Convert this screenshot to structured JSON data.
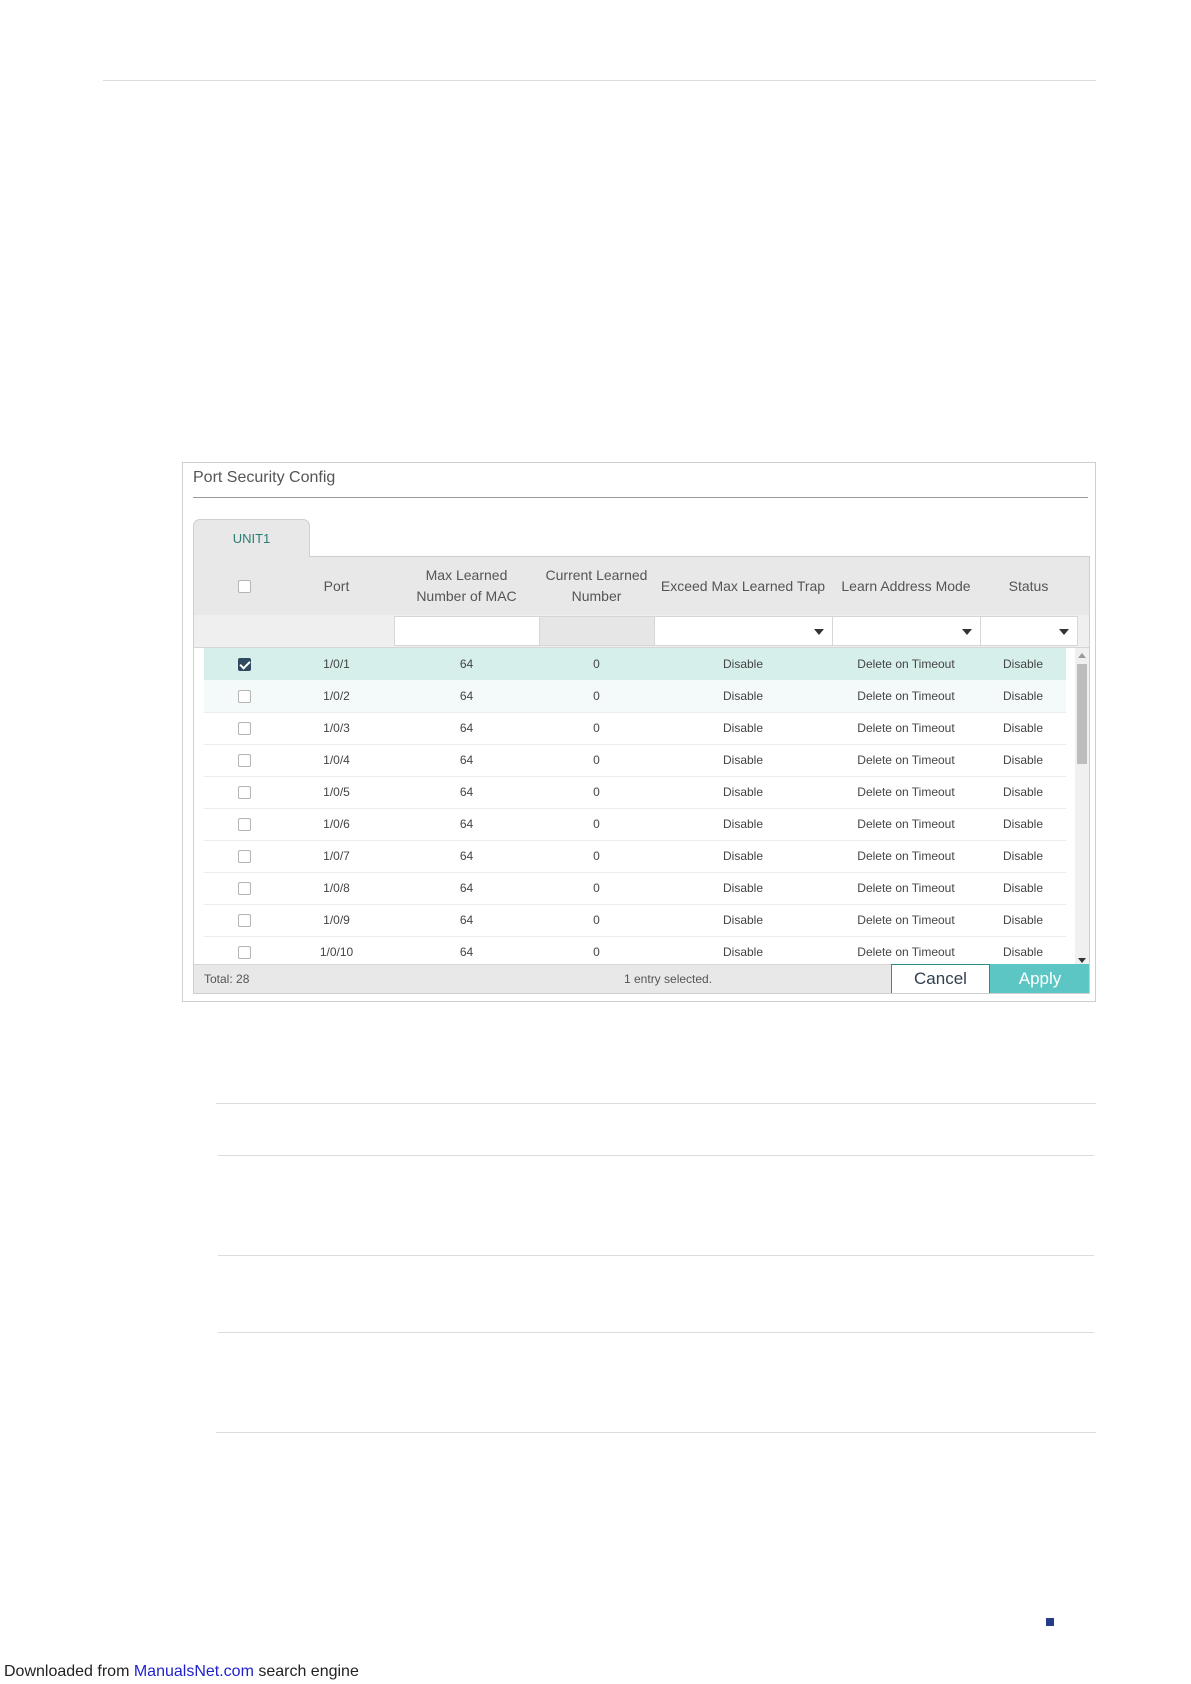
{
  "panel": {
    "title": "Port Security Config",
    "tab": "UNIT1"
  },
  "table": {
    "headers": {
      "port": "Port",
      "max_learned_l1": "Max Learned",
      "max_learned_l2": "Number of MAC",
      "current_learned_l1": "Current Learned",
      "current_learned_l2": "Number",
      "exceed_trap": "Exceed Max Learned Trap",
      "learn_mode": "Learn Address Mode",
      "status": "Status"
    },
    "rows": [
      {
        "port": "1/0/1",
        "max": "64",
        "current": "0",
        "trap": "Disable",
        "mode": "Delete on Timeout",
        "status": "Disable",
        "checked": true
      },
      {
        "port": "1/0/2",
        "max": "64",
        "current": "0",
        "trap": "Disable",
        "mode": "Delete on Timeout",
        "status": "Disable",
        "checked": false
      },
      {
        "port": "1/0/3",
        "max": "64",
        "current": "0",
        "trap": "Disable",
        "mode": "Delete on Timeout",
        "status": "Disable",
        "checked": false
      },
      {
        "port": "1/0/4",
        "max": "64",
        "current": "0",
        "trap": "Disable",
        "mode": "Delete on Timeout",
        "status": "Disable",
        "checked": false
      },
      {
        "port": "1/0/5",
        "max": "64",
        "current": "0",
        "trap": "Disable",
        "mode": "Delete on Timeout",
        "status": "Disable",
        "checked": false
      },
      {
        "port": "1/0/6",
        "max": "64",
        "current": "0",
        "trap": "Disable",
        "mode": "Delete on Timeout",
        "status": "Disable",
        "checked": false
      },
      {
        "port": "1/0/7",
        "max": "64",
        "current": "0",
        "trap": "Disable",
        "mode": "Delete on Timeout",
        "status": "Disable",
        "checked": false
      },
      {
        "port": "1/0/8",
        "max": "64",
        "current": "0",
        "trap": "Disable",
        "mode": "Delete on Timeout",
        "status": "Disable",
        "checked": false
      },
      {
        "port": "1/0/9",
        "max": "64",
        "current": "0",
        "trap": "Disable",
        "mode": "Delete on Timeout",
        "status": "Disable",
        "checked": false
      },
      {
        "port": "1/0/10",
        "max": "64",
        "current": "0",
        "trap": "Disable",
        "mode": "Delete on Timeout",
        "status": "Disable",
        "checked": false
      }
    ]
  },
  "footer": {
    "total": "Total: 28",
    "selected": "1 entry selected.",
    "cancel_label": "Cancel",
    "apply_label": "Apply"
  },
  "download": {
    "prefix": "Downloaded from ",
    "link": "ManualsNet.com",
    "suffix": " search engine"
  },
  "colors": {
    "accent": "#5bc6c4",
    "selected_row": "#d7efeb",
    "tab_text": "#2a7d74"
  }
}
